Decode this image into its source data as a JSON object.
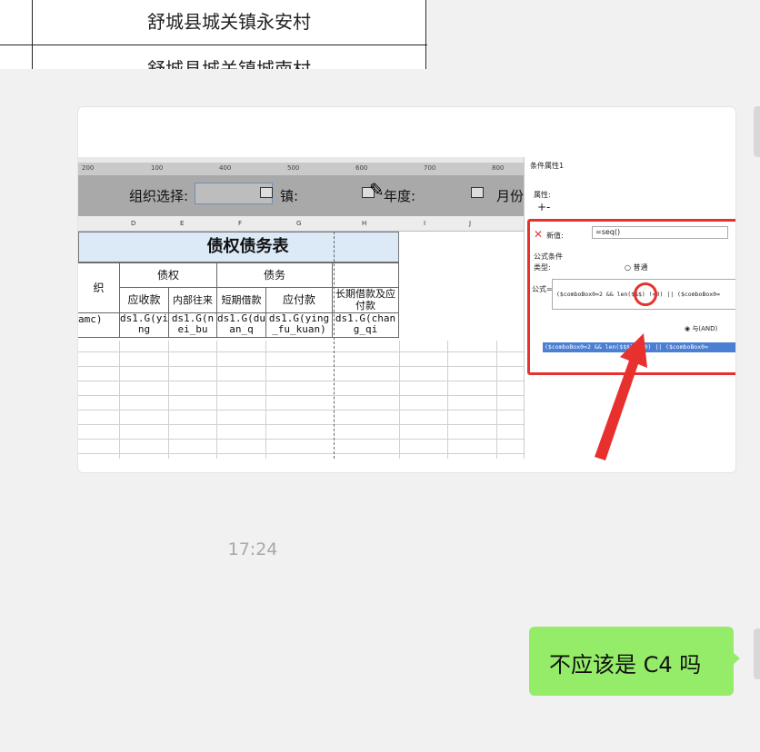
{
  "top_table": {
    "row1": "舒城县城关镇永安村",
    "row2": "舒城县城关镇城南村"
  },
  "screenshot": {
    "ruler_ticks": [
      "200",
      "100",
      "400",
      "500",
      "600",
      "700",
      "800"
    ],
    "form_labels": {
      "org_select": "组织选择:",
      "town": "镇:",
      "year": "年度:",
      "month": "月份"
    },
    "column_letters": [
      "D",
      "E",
      "F",
      "G",
      "H",
      "I",
      "J"
    ],
    "report_title": "债权债务表",
    "group_headers": {
      "left_partial": "织",
      "claims": "债权",
      "debts": "债务"
    },
    "sub_headers": [
      "应收款",
      "内部往来",
      "短期借款",
      "应付款",
      "长期借款及应付款"
    ],
    "data_cells": [
      "amc)",
      "ds1.G(ying",
      "ds1.G(nei_bu",
      "ds1.G(duan_q",
      "ds1.G(ying_fu_kuan)",
      "ds1.G(chang_qi"
    ],
    "panel": {
      "title": "条件属性1",
      "attr_label": "属性:",
      "plus": "+-",
      "new_value_label": "新值:",
      "new_value_text": "=seq()",
      "cond_label": "公式条件",
      "type_label": "类型:",
      "radio_normal": "普通",
      "formula_label": "公式=",
      "formula_text": "($comboBox0=2 && len($$$) !=0) || ($comboBox0=",
      "and_radio": "与(AND)",
      "selected_text": "($comboBox0=2 && len($$$) !=0) || ($comboBox0="
    }
  },
  "timestamp": "17:24",
  "message": "不应该是 C4 吗",
  "colors": {
    "chat_bg": "#f1f1f1",
    "green_bubble": "#95ec69",
    "annotation_red": "#e8312f"
  }
}
